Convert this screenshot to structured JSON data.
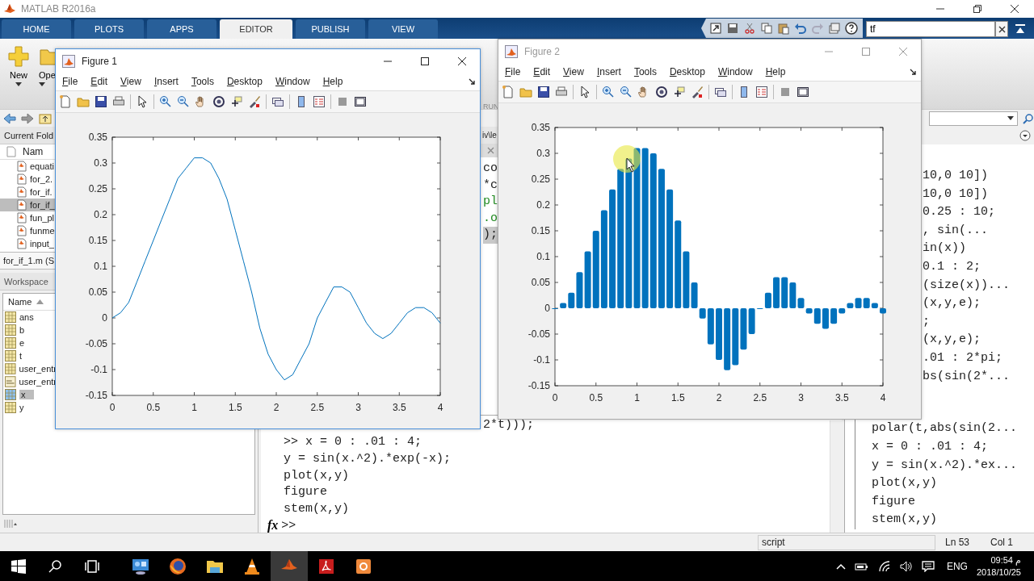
{
  "window": {
    "title": "MATLAB R2016a"
  },
  "ribbon_tabs": [
    {
      "label": "HOME",
      "selected": false
    },
    {
      "label": "PLOTS",
      "selected": false
    },
    {
      "label": "APPS",
      "selected": false
    },
    {
      "label": "EDITOR",
      "selected": true
    },
    {
      "label": "PUBLISH",
      "selected": false
    },
    {
      "label": "VIEW",
      "selected": false
    }
  ],
  "search": {
    "value": "tf"
  },
  "toolstrip": {
    "buttons": [
      {
        "label": "New",
        "kind": "new"
      },
      {
        "label": "Ope",
        "kind": "open"
      }
    ],
    "section_label": "RUN"
  },
  "editor": {
    "title_fragment": "iv\\le",
    "lines": [
      {
        "text": "co",
        "kind": "code",
        "current": false
      },
      {
        "text": "*c",
        "kind": "code",
        "current": false
      },
      {
        "text": "pl",
        "kind": "comment",
        "current": false
      },
      {
        "text": ".o",
        "kind": "comment",
        "current": false
      },
      {
        "text": ");",
        "kind": "code",
        "current": true
      }
    ]
  },
  "current_folder": {
    "title": "Current Fold",
    "column": "Nam",
    "files": [
      {
        "name": "equati",
        "selected": false
      },
      {
        "name": "for_2.",
        "selected": false
      },
      {
        "name": "for_if.",
        "selected": false
      },
      {
        "name": "for_if_",
        "selected": true
      },
      {
        "name": "fun_pl",
        "selected": false
      },
      {
        "name": "funme",
        "selected": false
      },
      {
        "name": "input_",
        "selected": false
      }
    ],
    "details": "for_if_1.m (S"
  },
  "workspace": {
    "title": "Workspace",
    "column": "Name",
    "variables": [
      {
        "name": "ans",
        "kind": "matrix",
        "selected": false
      },
      {
        "name": "b",
        "kind": "matrix",
        "selected": false
      },
      {
        "name": "e",
        "kind": "matrix",
        "selected": false
      },
      {
        "name": "t",
        "kind": "matrix",
        "selected": false
      },
      {
        "name": "user_entr",
        "kind": "matrix",
        "selected": false
      },
      {
        "name": "user_entr",
        "kind": "string",
        "selected": false
      },
      {
        "name": "x",
        "kind": "matrix",
        "selected": true
      },
      {
        "name": "y",
        "kind": "matrix",
        "selected": false
      }
    ]
  },
  "command_window": {
    "lines": [
      {
        "text": "2*t)));",
        "kind": "partial"
      },
      {
        "text": ">> x = 0 : .01 : 4;",
        "kind": "full"
      },
      {
        "text": "y = sin(x.^2).*exp(-x);",
        "kind": "full"
      },
      {
        "text": "plot(x,y)",
        "kind": "full"
      },
      {
        "text": "figure",
        "kind": "full"
      },
      {
        "text": "stem(x,y)",
        "kind": "full"
      }
    ],
    "function_button": "fx",
    "prompt": ">>"
  },
  "history": {
    "partial_lines": [
      "10,0 10])",
      "10,0 10])",
      "0.25 : 10;",
      ", sin(...",
      "in(x))",
      "0.1 : 2;",
      "(size(x))...",
      "(x,y,e);",
      ";",
      "(x,y,e);",
      ".01 : 2*pi;",
      "bs(sin(2*..."
    ],
    "lines": [
      "polar(t,abs(sin(2...",
      "x = 0 : .01 : 4;",
      "y = sin(x.^2).*ex...",
      "plot(x,y)",
      "figure",
      "stem(x,y)"
    ]
  },
  "status_bar": {
    "file_type": "script",
    "line": "Ln 53",
    "column": "Col 1"
  },
  "figures": [
    {
      "title": "Figure 1",
      "active": true,
      "menu": [
        "File",
        "Edit",
        "View",
        "Insert",
        "Tools",
        "Desktop",
        "Window",
        "Help"
      ],
      "chart_data": {
        "type": "line",
        "x": [
          0,
          0.1,
          0.2,
          0.3,
          0.4,
          0.5,
          0.6,
          0.7,
          0.8,
          0.9,
          1,
          1.1,
          1.2,
          1.3,
          1.4,
          1.5,
          1.6,
          1.7,
          1.8,
          1.9,
          2,
          2.1,
          2.2,
          2.3,
          2.4,
          2.5,
          2.6,
          2.7,
          2.8,
          2.9,
          3,
          3.1,
          3.2,
          3.3,
          3.4,
          3.5,
          3.6,
          3.7,
          3.8,
          3.9,
          4
        ],
        "series": [
          {
            "color": "#0072bd",
            "values": [
              0,
              0.01,
              0.03,
              0.07,
              0.11,
              0.15,
              0.19,
              0.23,
              0.27,
              0.29,
              0.31,
              0.31,
              0.3,
              0.27,
              0.23,
              0.17,
              0.11,
              0.05,
              -0.02,
              -0.07,
              -0.1,
              -0.12,
              -0.11,
              -0.08,
              -0.05,
              0,
              0.03,
              0.06,
              0.06,
              0.05,
              0.02,
              -0.01,
              -0.03,
              -0.04,
              -0.03,
              -0.01,
              0.01,
              0.02,
              0.02,
              0.01,
              -0.01
            ]
          }
        ],
        "xlim": [
          0,
          4
        ],
        "ylim": [
          -0.15,
          0.35
        ],
        "xticks": [
          0,
          0.5,
          1,
          1.5,
          2,
          2.5,
          3,
          3.5,
          4
        ],
        "yticks": [
          -0.15,
          -0.1,
          -0.05,
          0,
          0.05,
          0.1,
          0.15,
          0.2,
          0.25,
          0.3,
          0.35
        ]
      }
    },
    {
      "title": "Figure 2",
      "active": false,
      "menu": [
        "File",
        "Edit",
        "View",
        "Insert",
        "Tools",
        "Desktop",
        "Window",
        "Help"
      ],
      "chart_data": {
        "type": "bar",
        "x": [
          0,
          0.1,
          0.2,
          0.3,
          0.4,
          0.5,
          0.6,
          0.7,
          0.8,
          0.9,
          1,
          1.1,
          1.2,
          1.3,
          1.4,
          1.5,
          1.6,
          1.7,
          1.8,
          1.9,
          2,
          2.1,
          2.2,
          2.3,
          2.4,
          2.5,
          2.6,
          2.7,
          2.8,
          2.9,
          3,
          3.1,
          3.2,
          3.3,
          3.4,
          3.5,
          3.6,
          3.7,
          3.8,
          3.9,
          4
        ],
        "series": [
          {
            "color": "#0072bd",
            "values": [
              0,
              0.01,
              0.03,
              0.07,
              0.11,
              0.15,
              0.19,
              0.23,
              0.27,
              0.29,
              0.31,
              0.31,
              0.3,
              0.27,
              0.23,
              0.17,
              0.11,
              0.05,
              -0.02,
              -0.07,
              -0.1,
              -0.12,
              -0.11,
              -0.08,
              -0.05,
              0,
              0.03,
              0.06,
              0.06,
              0.05,
              0.02,
              -0.01,
              -0.03,
              -0.04,
              -0.03,
              -0.01,
              0.01,
              0.02,
              0.02,
              0.01,
              -0.01
            ]
          }
        ],
        "xlim": [
          0,
          4
        ],
        "ylim": [
          -0.15,
          0.35
        ],
        "xticks": [
          0,
          0.5,
          1,
          1.5,
          2,
          2.5,
          3,
          3.5,
          4
        ],
        "yticks": [
          -0.15,
          -0.1,
          -0.05,
          0,
          0.05,
          0.1,
          0.15,
          0.2,
          0.25,
          0.3,
          0.35
        ]
      }
    }
  ],
  "taskbar": {
    "apps": [
      {
        "kind": "monitor",
        "selected": false
      },
      {
        "kind": "browser",
        "selected": false
      },
      {
        "kind": "folder",
        "selected": false
      },
      {
        "kind": "cone",
        "selected": false
      },
      {
        "kind": "matlab",
        "selected": true
      },
      {
        "kind": "pdf",
        "selected": false
      },
      {
        "kind": "app",
        "selected": false
      }
    ],
    "language": "ENG",
    "time": "09:54 م",
    "date": "2018/10/25"
  }
}
